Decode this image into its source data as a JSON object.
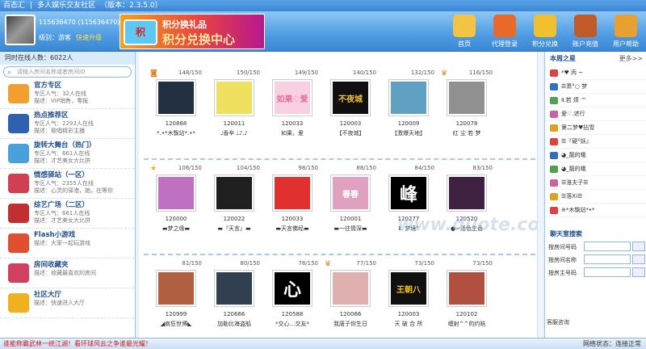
{
  "titlebar": {
    "app": "百态汇",
    "sep": "|",
    "community": "多人娱乐交友社区",
    "version": "（版本：2.3.5.0）"
  },
  "user": {
    "id": "115636470 (115636470)",
    "level": "级别：游客",
    "upgrade": "快速升级"
  },
  "banner": {
    "box": "积",
    "line1": "积分换礼品",
    "line2": "积分兑换中心"
  },
  "tools": [
    {
      "label": "首页",
      "icon": "home-icon",
      "color": "#f3c343"
    },
    {
      "label": "代理登录",
      "icon": "medal-icon",
      "color": "#e86a2a"
    },
    {
      "label": "积分兑换",
      "icon": "coins-icon",
      "color": "#f0c030"
    },
    {
      "label": "账户充值",
      "icon": "wallet-icon",
      "color": "#c05a2a"
    },
    {
      "label": "用户帮助",
      "icon": "help-icon",
      "color": "#e8a030"
    }
  ],
  "sidebar": {
    "online": "同时在线人数：6022人",
    "search_placeholder": "请输入房间名称或者房间ID",
    "items": [
      {
        "title": "官方专区",
        "l1": "专区人气：32人在线",
        "l2": "描述：VIP销售，零报",
        "color": "#f0a030"
      },
      {
        "title": "热点推荐区",
        "l1": "专区人气：2293人在线",
        "l2": "描述：歌唱精彩主播",
        "color": "#3060b0"
      },
      {
        "title": "旋转大舞台（热门）",
        "l1": "专区人气：661人在线",
        "l2": "描述：才艺美女大比拼",
        "color": "#4aa0d8"
      },
      {
        "title": "情感驿站（一区）",
        "l1": "专区人气：2355人在线",
        "l2": "描述：心灵的驿港，她，在等你",
        "color": "#d04050"
      },
      {
        "title": "综艺广场（二区）",
        "l1": "专区人气：661人在线",
        "l2": "描述：才艺美女大比拼",
        "color": "#c03030"
      },
      {
        "title": "Flash小游戏",
        "l1": "描述：大家一起玩游戏",
        "l2": "",
        "color": "#e05030"
      },
      {
        "title": "房间收藏夹",
        "l1": "描述：收藏最喜欢的房间",
        "l2": "",
        "color": "#d04060"
      },
      {
        "title": "社区大厅",
        "l1": "描述：快速进入大厅",
        "l2": "",
        "color": "#f0b020"
      }
    ]
  },
  "rooms": [
    [
      {
        "count": "148/150",
        "id": "120888",
        "name": "*.•*木飘站*.•*",
        "mark": "badge",
        "bg": "#203040",
        "fg": "#fff",
        "txt": ""
      },
      {
        "count": "150/150",
        "id": "120011",
        "name": "♩香辛 ♩♪.♪",
        "mark": "",
        "bg": "#f0e060",
        "fg": "#c03060",
        "txt": ""
      },
      {
        "count": "149/150",
        "id": "120033",
        "name": "如果，爱",
        "mark": "",
        "bg": "#f8d0e0",
        "fg": "#e070a0",
        "txt": "如果♡爱"
      },
      {
        "count": "140/150",
        "id": "120003",
        "name": "【不夜城】",
        "mark": "",
        "bg": "#101010",
        "fg": "#f0c040",
        "txt": "不夜城"
      },
      {
        "count": "132/150",
        "id": "120009",
        "name": "【激爆天地】",
        "mark": "",
        "bg": "#60a0c0",
        "fg": "#fff",
        "txt": ""
      },
      {
        "count": "116/150",
        "id": "120078",
        "name": "红 尘 若 梦",
        "mark": "crown",
        "bg": "#909090",
        "fg": "#fff",
        "txt": ""
      }
    ],
    [
      {
        "count": "106/150",
        "id": "120000",
        "name": "▬梦之缘▬",
        "mark": "star",
        "bg": "#c070c0",
        "fg": "#fff",
        "txt": ""
      },
      {
        "count": "104/150",
        "id": "120022",
        "name": "▬『天言』▬",
        "mark": "",
        "bg": "#202020",
        "fg": "#fff",
        "txt": ""
      },
      {
        "count": "98/150",
        "id": "120033",
        "name": "▬天言佛经▬",
        "mark": "",
        "bg": "#e03030",
        "fg": "#fff",
        "txt": ""
      },
      {
        "count": "88/150",
        "id": "120001",
        "name": "▬一往情深▬",
        "mark": "",
        "bg": "#e0a0c0",
        "fg": "#fff",
        "txt": "春春"
      },
      {
        "count": "84/150",
        "id": "120277",
        "name": "Ⅱ. 梦境°",
        "mark": "",
        "bg": "#000",
        "fg": "#fff",
        "txt": "峰"
      },
      {
        "count": "83/150",
        "id": "120520",
        "name": "●~活色生香",
        "mark": "",
        "bg": "#402040",
        "fg": "#fff",
        "txt": ""
      }
    ],
    [
      {
        "count": "81/150",
        "id": "120999",
        "name": "◢疯狂世博◣",
        "mark": "",
        "bg": "#b06040",
        "fg": "#fff",
        "txt": ""
      },
      {
        "count": "80/150",
        "id": "120666",
        "name": "加勒比海盗船",
        "mark": "",
        "bg": "#304050",
        "fg": "#fff",
        "txt": ""
      },
      {
        "count": "78/150",
        "id": "120588",
        "name": "*交心…交友*",
        "mark": "",
        "bg": "#000",
        "fg": "#fff",
        "txt": "心"
      },
      {
        "count": "77/150",
        "id": "120066",
        "name": "我唐子你生日",
        "mark": "crown",
        "bg": "#e0b0b0",
        "fg": "#fff",
        "txt": ""
      },
      {
        "count": "73/150",
        "id": "120003",
        "name": "天 破 合 所",
        "mark": "",
        "bg": "#101010",
        "fg": "#f0c020",
        "txt": "王朝八"
      },
      {
        "count": "73/150",
        "id": "120102",
        "name": "缠射^^的约晗",
        "mark": "",
        "bg": "#b05040",
        "fg": "#fff",
        "txt": ""
      }
    ]
  ],
  "right": {
    "stars_title": "本周之星",
    "more": "更多>>",
    "stars": [
      "*♥ 丙 ~",
      "☰萧°○ 梦",
      "Ⅱ.若 烦 ™",
      "爱♡.述行",
      "第二梦♥拈雪",
      "☰『硬°妖』",
      "◕_靓的蛾",
      "◕_靓的蛾",
      "☰淮夫子☰",
      "☰落Xi☰",
      "※*木飘站*•*"
    ],
    "chat_title": "聊天室搜索",
    "chat_fields": [
      "按房间号码",
      "按房间名称",
      "按房主号码"
    ],
    "service": "客服咨询"
  },
  "status": {
    "marquee": "谁能称霸武林一统江湖！看环球风云之争谁最光耀！",
    "state": "网络状态：连接正常"
  }
}
